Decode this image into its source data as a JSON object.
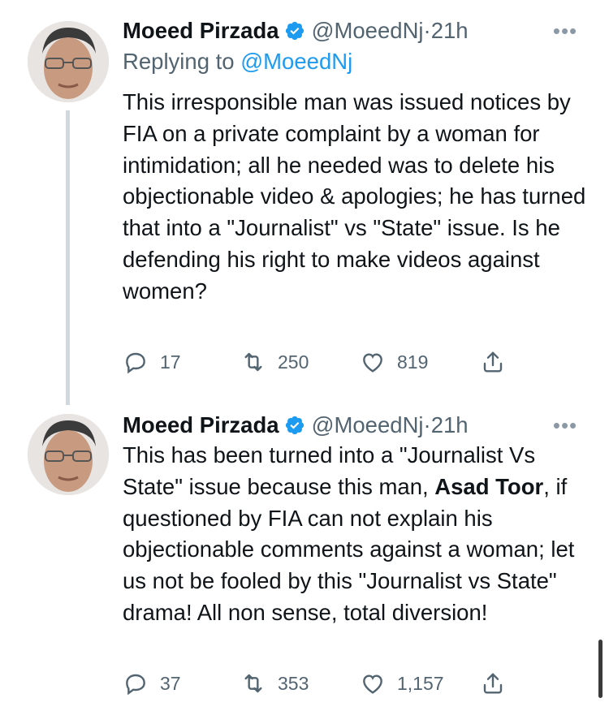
{
  "colors": {
    "accent": "#1d9bf0",
    "secondary_text": "#536471",
    "thread_line": "#cfd9de"
  },
  "tweets": [
    {
      "author_name": "Moeed Pirzada",
      "handle": "@MoeedNj",
      "separator": "·",
      "time": "21h",
      "replying_prefix": "Replying to",
      "replying_to": "@MoeedNj",
      "text": "This irresponsible man was issued notices by FIA on a private complaint by a woman for intimidation; all he needed was to delete his objectionable video & apologies; he has turned that into a \"Journalist\" vs \"State\" issue. Is he defending his right to make videos against women?",
      "replies": "17",
      "retweets": "250",
      "likes": "819"
    },
    {
      "author_name": "Moeed Pirzada",
      "handle": "@MoeedNj",
      "separator": "·",
      "time": "21h",
      "text_before": "This has been turned into a \"Journalist Vs State\" issue because this man, ",
      "text_bold": "Asad Toor",
      "text_after": ", if questioned by FIA can not explain his objectionable comments against a woman; let us not be fooled by this \"Journalist vs State\" drama! All non sense, total diversion!",
      "replies": "37",
      "retweets": "353",
      "likes": "1,157"
    }
  ],
  "icons": {
    "verified": "verified-badge-icon",
    "more": "more-options-icon",
    "reply": "reply-icon",
    "retweet": "retweet-icon",
    "like": "like-icon",
    "share": "share-icon"
  }
}
